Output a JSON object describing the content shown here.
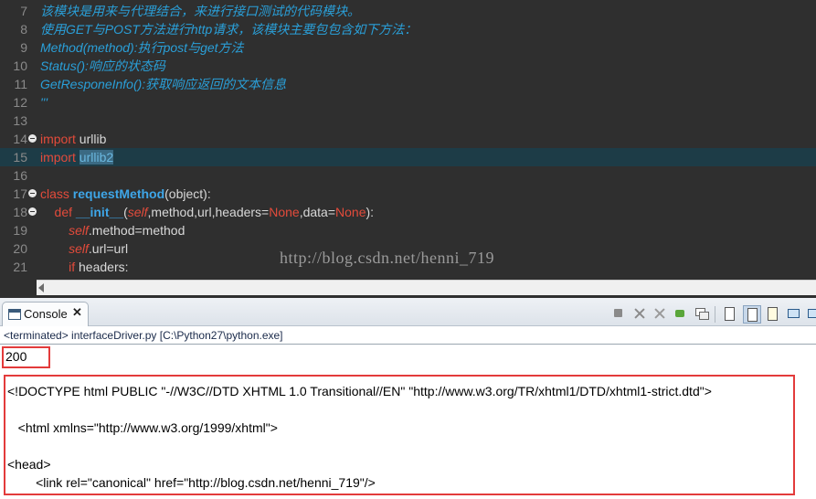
{
  "editor": {
    "lines": [
      {
        "num": "7",
        "segments": [
          {
            "t": "该模块是用来与代理结合，来进行接口测试的代码模块。",
            "c": "comment"
          }
        ]
      },
      {
        "num": "8",
        "segments": [
          {
            "t": "使用GET与POST方法进行http请求，该模块主要包包含如下方法：",
            "c": "comment"
          }
        ]
      },
      {
        "num": "9",
        "segments": [
          {
            "t": "Method(method):执行post与get方法",
            "c": "comment"
          }
        ]
      },
      {
        "num": "10",
        "segments": [
          {
            "t": "Status():响应的状态码",
            "c": "comment"
          }
        ]
      },
      {
        "num": "11",
        "segments": [
          {
            "t": "GetResponeInfo():获取响应返回的文本信息",
            "c": "comment"
          }
        ]
      },
      {
        "num": "12",
        "segments": [
          {
            "t": "'''",
            "c": "comment"
          }
        ]
      },
      {
        "num": "13",
        "segments": []
      },
      {
        "num": "14",
        "fold": true,
        "segments": [
          {
            "t": "import",
            "c": "kw"
          },
          {
            "t": " urllib",
            "c": "plain"
          }
        ]
      },
      {
        "num": "15",
        "highlight": true,
        "segments": [
          {
            "t": "import",
            "c": "kw"
          },
          {
            "t": " ",
            "c": "plain"
          },
          {
            "t": "urllib2",
            "c": "sel"
          }
        ]
      },
      {
        "num": "16",
        "segments": []
      },
      {
        "num": "17",
        "fold": true,
        "segments": [
          {
            "t": "class",
            "c": "kw"
          },
          {
            "t": " ",
            "c": "plain"
          },
          {
            "t": "requestMethod",
            "c": "fn"
          },
          {
            "t": "(object):",
            "c": "plain"
          }
        ]
      },
      {
        "num": "18",
        "fold": true,
        "segments": [
          {
            "t": "    def",
            "c": "kw"
          },
          {
            "t": " ",
            "c": "plain"
          },
          {
            "t": "__init__",
            "c": "fn"
          },
          {
            "t": "(",
            "c": "plain"
          },
          {
            "t": "self",
            "c": "selfw"
          },
          {
            "t": ",method,url,headers=",
            "c": "plain"
          },
          {
            "t": "None",
            "c": "none"
          },
          {
            "t": ",data=",
            "c": "plain"
          },
          {
            "t": "None",
            "c": "none"
          },
          {
            "t": "):",
            "c": "plain"
          }
        ]
      },
      {
        "num": "19",
        "segments": [
          {
            "t": "        ",
            "c": "plain"
          },
          {
            "t": "self",
            "c": "selfw"
          },
          {
            "t": ".method=method",
            "c": "plain"
          }
        ]
      },
      {
        "num": "20",
        "segments": [
          {
            "t": "        ",
            "c": "plain"
          },
          {
            "t": "self",
            "c": "selfw"
          },
          {
            "t": ".url=url",
            "c": "plain"
          }
        ]
      },
      {
        "num": "21",
        "segments": [
          {
            "t": "        if",
            "c": "kw"
          },
          {
            "t": " headers:",
            "c": "plain"
          }
        ]
      }
    ],
    "watermark": "http://blog.csdn.net/henni_719"
  },
  "console": {
    "tab_label": "Console",
    "tab_close": "✕",
    "info": "<terminated> interfaceDriver.py [C:\\Python27\\python.exe]",
    "status_output": "200",
    "html_output": [
      "<!DOCTYPE html PUBLIC \"-//W3C//DTD XHTML 1.0 Transitional//EN\" \"http://www.w3.org/TR/xhtml1/DTD/xhtml1-strict.dtd\">",
      "",
      "   <html xmlns=\"http://www.w3.org/1999/xhtml\">",
      "",
      "<head>",
      "        <link rel=\"canonical\" href=\"http://blog.csdn.net/henni_719\"/>"
    ],
    "toolbar_icons": [
      "stop-icon",
      "remove-launch-icon",
      "remove-all-icon",
      "pin-console-icon",
      "display-console-icon",
      "clear-console-icon",
      "scroll-lock-icon",
      "word-wrap-icon",
      "show-on-output-icon",
      "open-console-icon"
    ]
  }
}
